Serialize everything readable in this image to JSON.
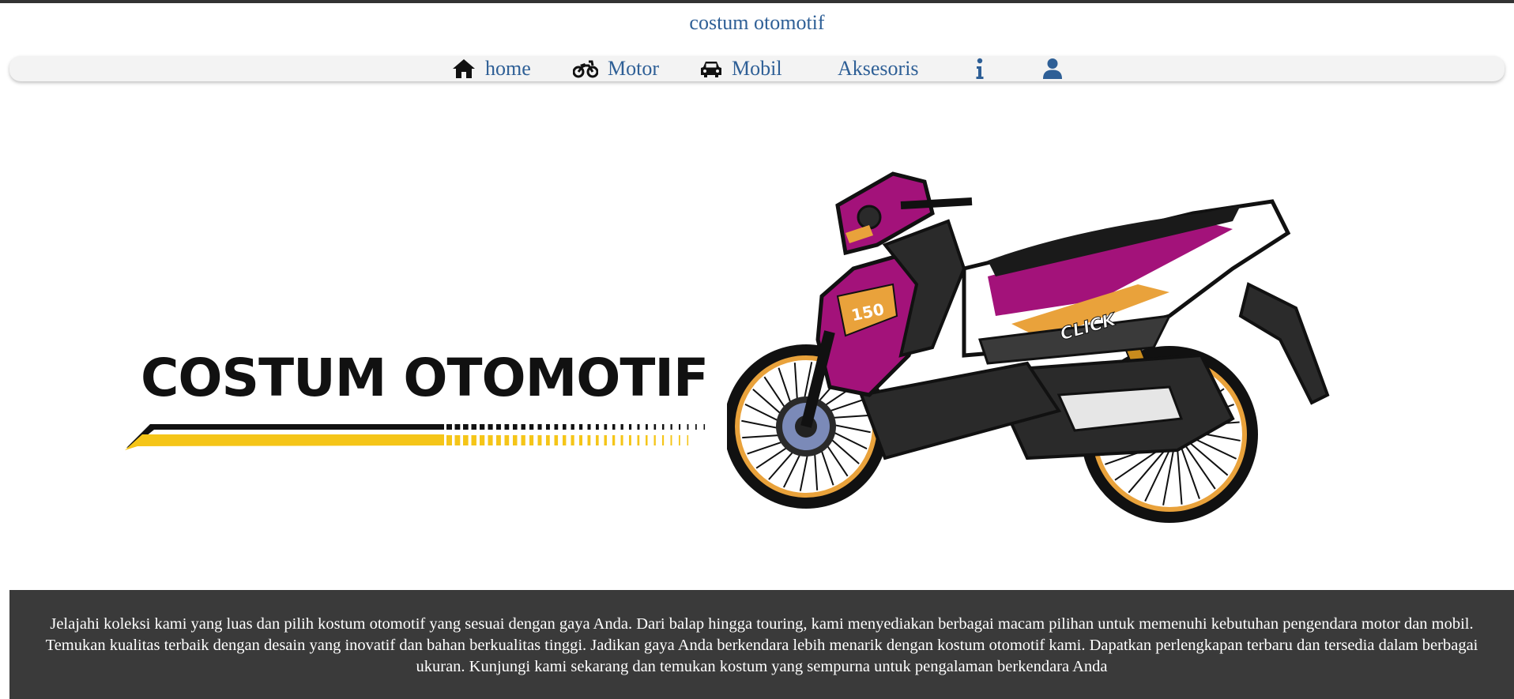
{
  "site": {
    "title": "costum otomotif"
  },
  "nav": {
    "items": [
      {
        "label": "home",
        "icon": "home-icon"
      },
      {
        "label": "Motor",
        "icon": "motorcycle-icon"
      },
      {
        "label": "Mobil",
        "icon": "car-icon"
      },
      {
        "label": "Aksesoris",
        "icon": ""
      },
      {
        "label": "",
        "icon": "info-icon"
      },
      {
        "label": "",
        "icon": "user-icon"
      }
    ]
  },
  "hero": {
    "brand_text": "COSTUM OTOMOTIF",
    "badge_number": "150",
    "side_text": "CLICK"
  },
  "banner": {
    "text": "Jelajahi koleksi kami yang luas dan pilih kostum otomotif yang sesuai dengan gaya Anda. Dari balap hingga touring, kami menyediakan berbagai macam pilihan untuk memenuhi kebutuhan pengendara motor dan mobil. Temukan kualitas terbaik dengan desain yang inovatif dan bahan berkualitas tinggi. Jadikan gaya Anda berkendara lebih menarik dengan kostum otomotif kami. Dapatkan perlengkapan terbaru dan tersedia dalam berbagai ukuran. Kunjungi kami sekarang dan temukan kostum yang sempurna untuk pengalaman berkendara Anda"
  },
  "colors": {
    "link": "#2e5f96",
    "banner_bg": "#3a3a3a",
    "accent_yellow": "#f5c518",
    "body_magenta": "#a3127a"
  }
}
